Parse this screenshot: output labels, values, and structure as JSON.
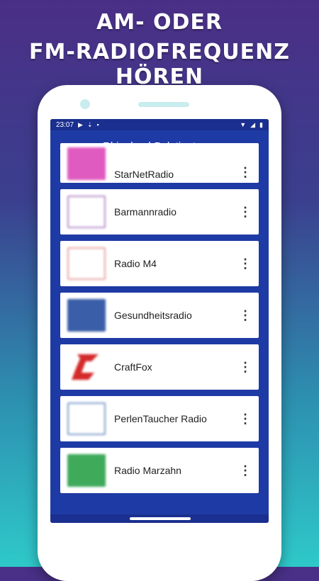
{
  "promo": {
    "line1": "AM- ODER",
    "line2": "FM-RADIOFREQUENZ HÖREN"
  },
  "status_bar": {
    "time": "23:07"
  },
  "app_bar": {
    "title": "Rhineland-Palatinate",
    "back_icon": "arrow-back-icon"
  },
  "stations": [
    {
      "name": "StarNetRadio",
      "thumb_color": "#e05bc0"
    },
    {
      "name": "Barmannradio",
      "thumb_color": "#b58ac8"
    },
    {
      "name": "Radio M4",
      "thumb_color": "#e8a0a0"
    },
    {
      "name": "Gesundheitsradio",
      "thumb_color": "#3a5fa8"
    },
    {
      "name": "CraftFox",
      "thumb_color": "#d42a2a"
    },
    {
      "name": "PerlenTaucher Radio",
      "thumb_color": "#7a9ac8"
    },
    {
      "name": "Radio Marzahn",
      "thumb_color": "#3faa5a"
    }
  ],
  "colors": {
    "primary": "#1e3aa5",
    "status": "#1a2f8f",
    "accent_text": "#ffffff"
  }
}
